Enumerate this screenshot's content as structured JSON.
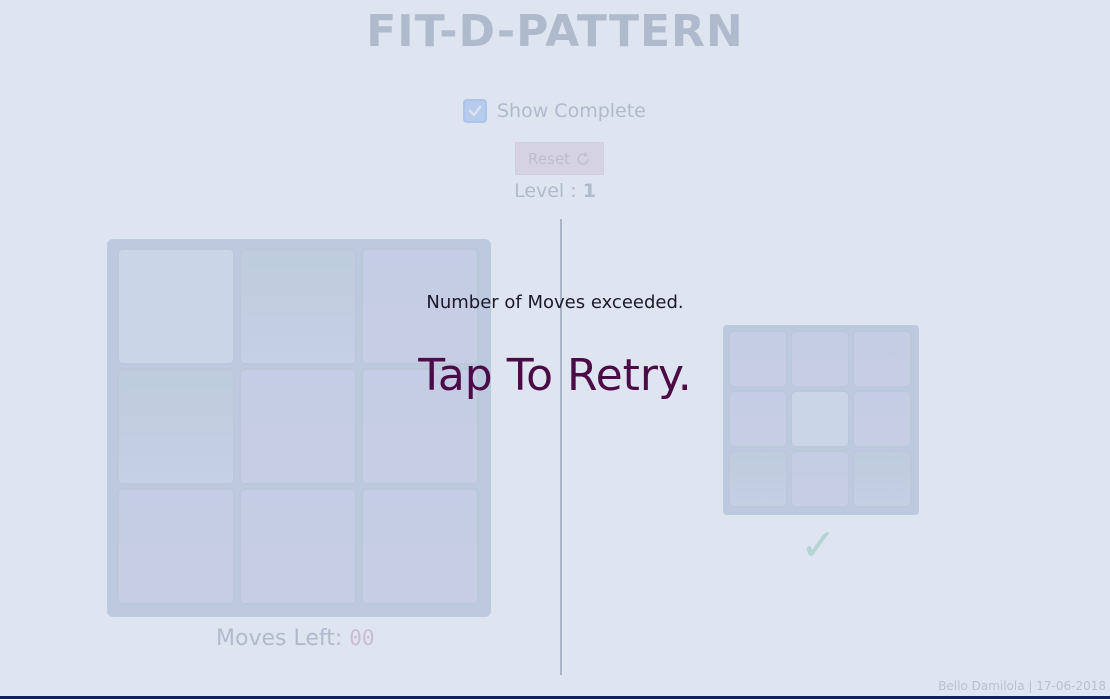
{
  "app": {
    "title": "FIT-D-PATTERN",
    "show_complete_label": "Show Complete",
    "show_complete_checked": true,
    "reset_label": "Reset",
    "level_label": "Level : ",
    "level_value": "1"
  },
  "boards": {
    "main_tiles": [
      "white",
      "green",
      "purple",
      "green",
      "purple",
      "purple",
      "purple",
      "purple",
      "purple"
    ],
    "target_tiles": [
      "purple",
      "purple",
      "purple",
      "purple",
      "white",
      "purple",
      "green",
      "purple",
      "green"
    ]
  },
  "status": {
    "moves_left_label": "Moves Left: ",
    "moves_left_value": "00",
    "complete_mark": "✓"
  },
  "overlay": {
    "message": "Number of Moves exceeded.",
    "retry_label": "Tap To Retry."
  },
  "footer": {
    "credit": "Bello Damilola | 17-06-2018"
  },
  "colors": {
    "overlay": "#c3d0e4",
    "retry_text": "#4b0b47",
    "tile_white": "#d5dced",
    "tile_green": "#b7c8d4",
    "tile_purple": "#c6c9e6",
    "check_mark": "#9fd9bd",
    "bottom_bar": "#10205a"
  },
  "icons": {
    "checkbox": "check-icon",
    "reset": "refresh-icon",
    "complete": "checkmark-icon"
  }
}
